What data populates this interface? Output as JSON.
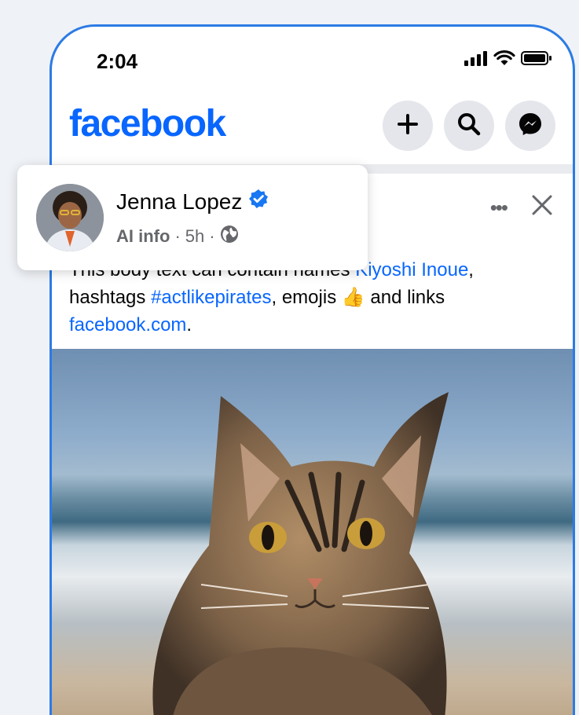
{
  "status_bar": {
    "time": "2:04"
  },
  "header": {
    "logo": "facebook"
  },
  "icons": {
    "plus": "plus-icon",
    "search": "search-icon",
    "messenger": "messenger-icon",
    "more": "more-icon",
    "close": "close-icon",
    "verified": "verified-badge-icon",
    "globe": "globe-icon"
  },
  "post": {
    "author": "Jenna Lopez",
    "ai_info": "AI info",
    "separator": "·",
    "time": "5h",
    "more_label": "•••",
    "body_intro": "This body text can contain names ",
    "mention": "Kiyoshi Inoue",
    "text_hashtags": ", hashtags ",
    "hashtag": "#actlikepirates",
    "text_emojis": ", emojis ",
    "emoji": "👍",
    "text_links": " and links ",
    "link": "facebook.com",
    "end": "."
  },
  "colors": {
    "brand": "#0866ff",
    "border": "#2c7be5",
    "button_bg": "#e4e6eb",
    "verified": "#1877f2"
  }
}
